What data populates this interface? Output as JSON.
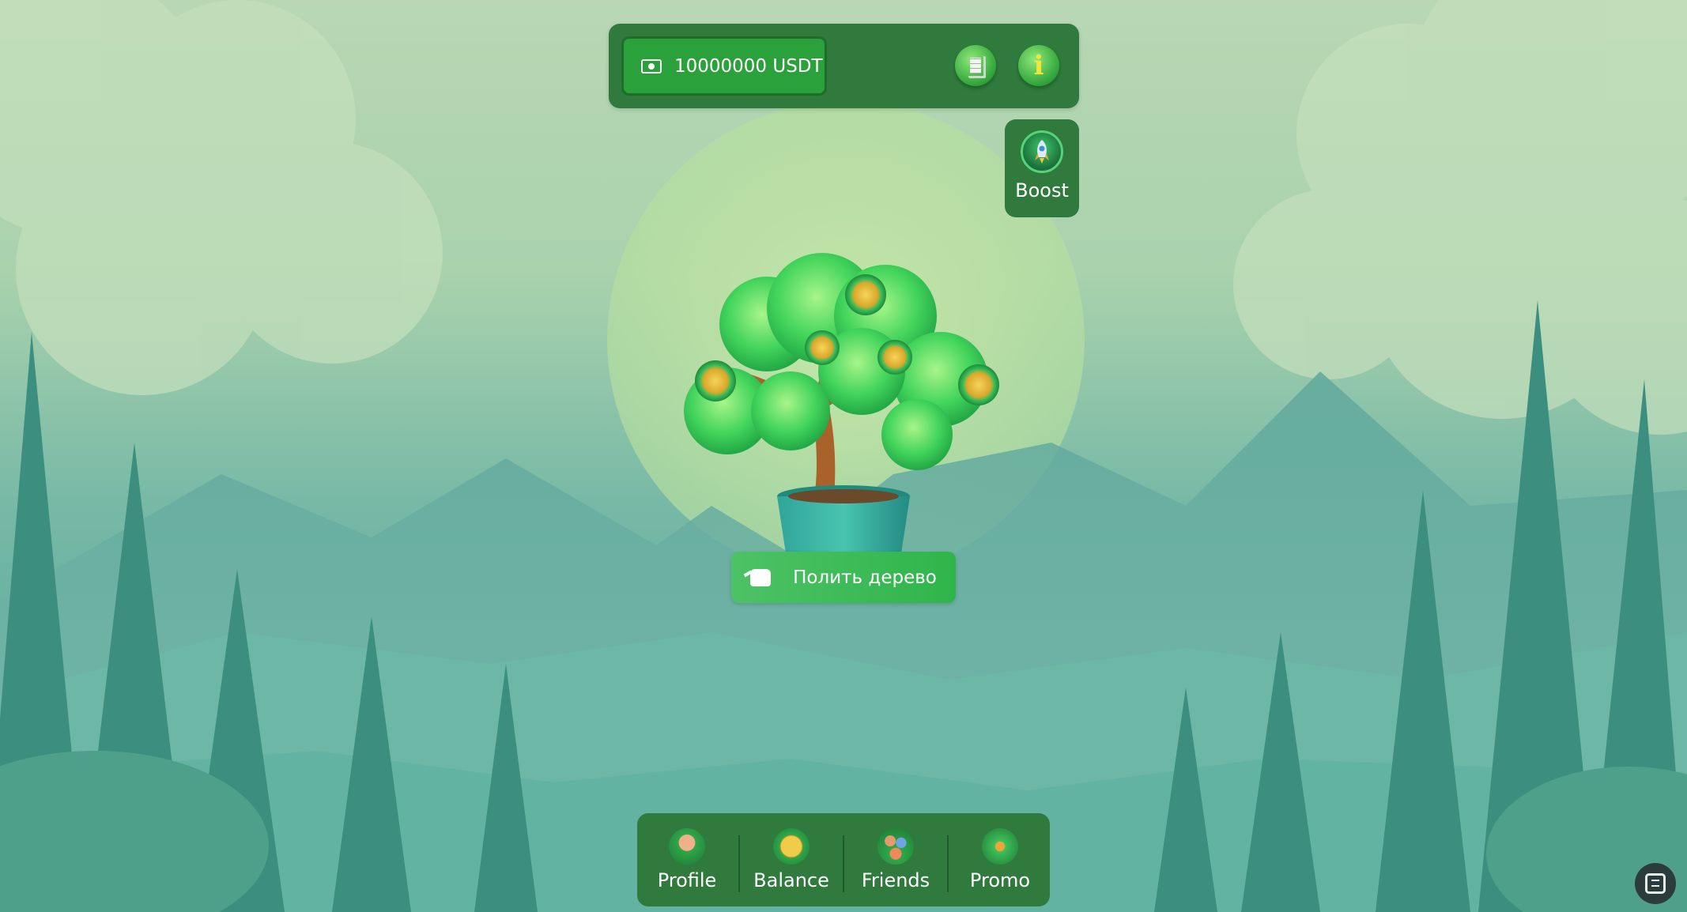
{
  "header": {
    "balance_text": "10000000 USDT",
    "history_icon": "document-icon",
    "info_icon": "info-icon"
  },
  "boost": {
    "label": "Boost",
    "icon": "rocket-icon"
  },
  "main": {
    "water_button_label": "Полить дерево",
    "water_icon": "watering-can-icon"
  },
  "nav": {
    "items": [
      {
        "label": "Profile",
        "icon": "profile-icon"
      },
      {
        "label": "Balance",
        "icon": "coin-icon"
      },
      {
        "label": "Friends",
        "icon": "friends-icon"
      },
      {
        "label": "Promo",
        "icon": "promo-icon"
      }
    ]
  },
  "colors": {
    "panel": "#2f7a3c",
    "accent": "#2fb54a",
    "balance_box": "#2aa13a"
  }
}
